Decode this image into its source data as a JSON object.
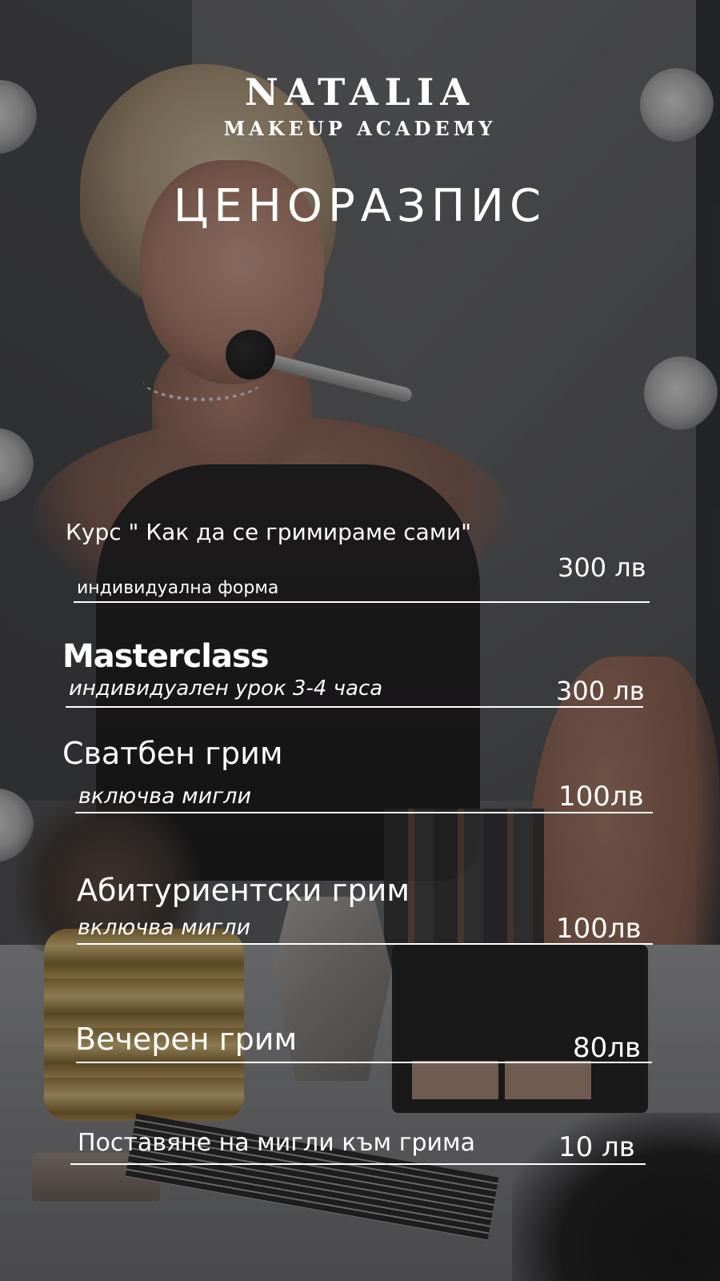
{
  "brand": {
    "name": "NATALIA",
    "subtitle": "MAKEUP ACADEMY"
  },
  "title": "ЦЕНОРАЗПИС",
  "items": [
    {
      "title": "Курс \" Как да се гримираме сами\"",
      "description": "индивидуална форма",
      "price": "300 лв"
    },
    {
      "title": "Masterclass",
      "description": "индивидуален урок 3-4 часа",
      "price": "300 лв"
    },
    {
      "title": "Сватбен грим",
      "description": "включва мигли",
      "price": "100лв"
    },
    {
      "title": "Абитуриентски грим",
      "description": "включва мигли",
      "price": "100лв"
    },
    {
      "title": "Вечерен грим",
      "price": "80лв"
    },
    {
      "title": "Поставяне на мигли към грима",
      "price": "10 лв"
    }
  ],
  "colors": {
    "text": "#ffffff",
    "overlay": "#161618"
  }
}
